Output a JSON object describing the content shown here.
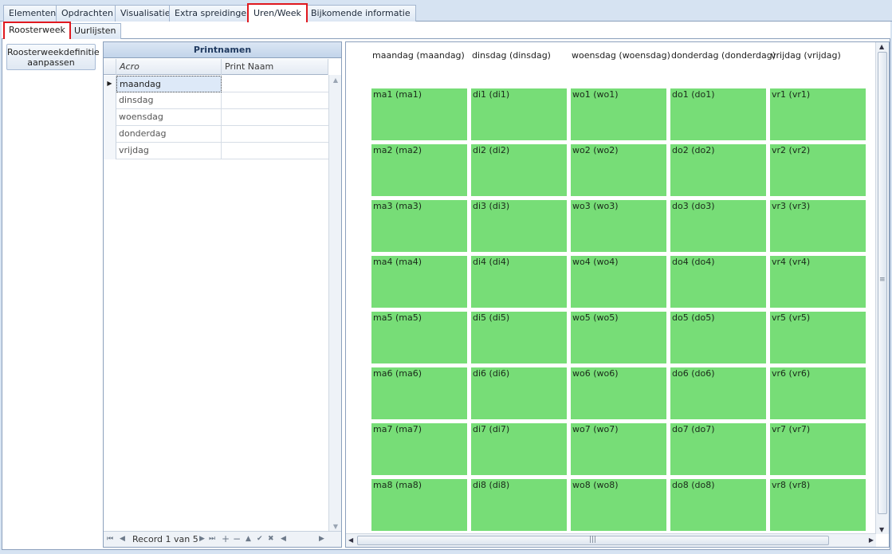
{
  "top_tabs": [
    "Elementen",
    "Opdrachten",
    "Visualisatie",
    "Extra spreidingen",
    "Uren/Week",
    "Bijkomende informatie"
  ],
  "active_top_tab": "Uren/Week",
  "sub_tabs": [
    "Roosterweek",
    "Uurlijsten"
  ],
  "active_sub_tab": "Roosterweek",
  "left_button": "Roosterweekdefinitie aanpassen",
  "grid": {
    "caption": "Printnamen",
    "columns": [
      "Acro",
      "Print Naam"
    ],
    "rows": [
      {
        "acro": "maandag",
        "print": ""
      },
      {
        "acro": "dinsdag",
        "print": ""
      },
      {
        "acro": "woensdag",
        "print": ""
      },
      {
        "acro": "donderdag",
        "print": ""
      },
      {
        "acro": "vrijdag",
        "print": ""
      }
    ],
    "record_text": "Record 1 van 5"
  },
  "schedule": {
    "days": [
      "maandag (maandag)",
      "dinsdag (dinsdag)",
      "woensdag (woensdag)",
      "donderdag (donderdag)",
      "vrijdag (vrijdag)"
    ],
    "slots": [
      [
        "ma1 (ma1)",
        "di1 (di1)",
        "wo1 (wo1)",
        "do1 (do1)",
        "vr1 (vr1)"
      ],
      [
        "ma2 (ma2)",
        "di2 (di2)",
        "wo2 (wo2)",
        "do2 (do2)",
        "vr2 (vr2)"
      ],
      [
        "ma3 (ma3)",
        "di3 (di3)",
        "wo3 (wo3)",
        "do3 (do3)",
        "vr3 (vr3)"
      ],
      [
        "ma4 (ma4)",
        "di4 (di4)",
        "wo4 (wo4)",
        "do4 (do4)",
        "vr4 (vr4)"
      ],
      [
        "ma5 (ma5)",
        "di5 (di5)",
        "wo5 (wo5)",
        "do5 (do5)",
        "vr5 (vr5)"
      ],
      [
        "ma6 (ma6)",
        "di6 (di6)",
        "wo6 (wo6)",
        "do6 (do6)",
        "vr6 (vr6)"
      ],
      [
        "ma7 (ma7)",
        "di7 (di7)",
        "wo7 (wo7)",
        "do7 (do7)",
        "vr7 (vr7)"
      ],
      [
        "ma8 (ma8)",
        "di8 (di8)",
        "wo8 (wo8)",
        "do8 (do8)",
        "vr8 (vr8)"
      ]
    ],
    "slot_color": "#77dd77"
  },
  "colors": {
    "highlight_border": "#e0191f",
    "frame_border": "#8ba0bc"
  }
}
